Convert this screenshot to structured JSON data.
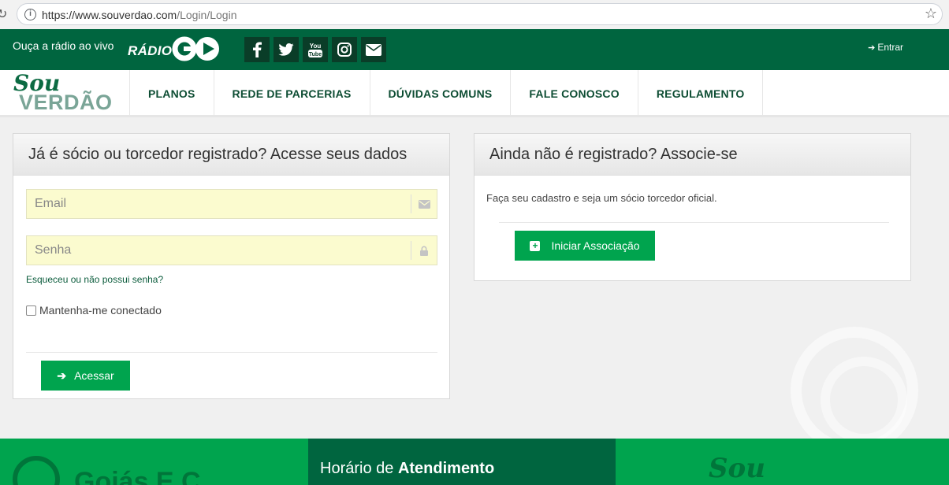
{
  "browser": {
    "url_main": "https://www.souverdao.com",
    "url_path": "/Login/Login"
  },
  "topbar": {
    "radio_text": "Ouça a rádio ao vivo",
    "radio_logo_word": "RÁDIO",
    "social": [
      {
        "icon": "facebook-icon",
        "glyph": "f"
      },
      {
        "icon": "twitter-icon",
        "glyph": "t"
      },
      {
        "icon": "youtube-icon",
        "glyph": "You Tube"
      },
      {
        "icon": "instagram-icon",
        "glyph": "◎"
      },
      {
        "icon": "mail-icon",
        "glyph": "✉"
      }
    ],
    "login_label": "Entrar"
  },
  "nav": {
    "logo_top": "Sou",
    "logo_bottom": "VERDÃO",
    "items": [
      "PLANOS",
      "REDE DE PARCERIAS",
      "DÚVIDAS COMUNS",
      "FALE CONOSCO",
      "REGULAMENTO"
    ]
  },
  "login_panel": {
    "title": "Já é sócio ou torcedor registrado? Acesse seus dados",
    "email_placeholder": "Email",
    "password_placeholder": "Senha",
    "forgot_link": "Esqueceu ou não possui senha?",
    "remember_label": "Mantenha-me conectado",
    "submit_label": "Acessar"
  },
  "signup_panel": {
    "title": "Ainda não é registrado? Associe-se",
    "text": "Faça seu cadastro e seja um sócio torcedor oficial.",
    "button_label": "Iniciar Associação"
  },
  "footer": {
    "club_name": "Goiás E.C.",
    "hours_prefix": "Horário de ",
    "hours_bold": "Atendimento",
    "logo_top": "Sou"
  },
  "colors": {
    "dark_green": "#00653f",
    "button_green": "#00a44e",
    "field_yellow": "#fbfbcf"
  }
}
